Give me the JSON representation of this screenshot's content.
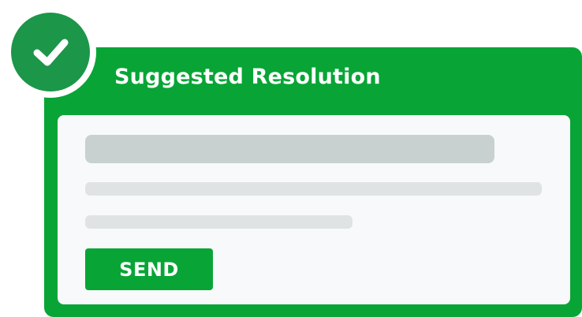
{
  "card": {
    "title": "Suggested Resolution",
    "send_label": "SEND"
  },
  "badge": {
    "icon": "check-icon"
  },
  "colors": {
    "brand_green": "#08a536",
    "badge_green": "#1c9649",
    "panel_bg": "#f8f9fa",
    "skeleton_dark": "#c8d1cf",
    "skeleton_light": "#e0e3e4"
  }
}
